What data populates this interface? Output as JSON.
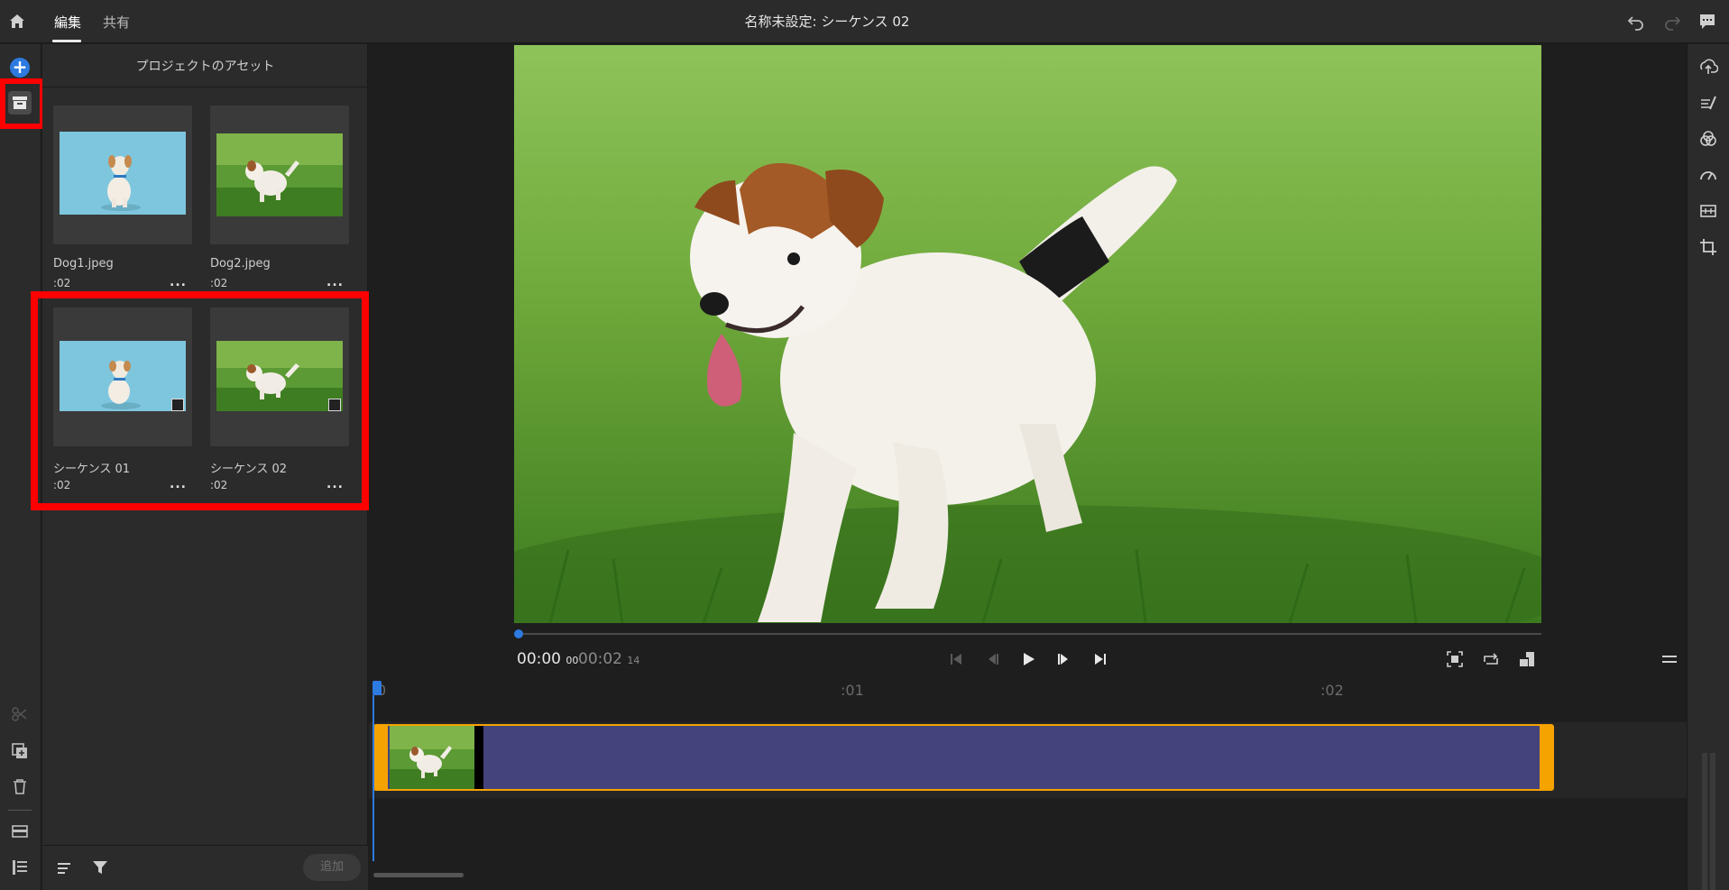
{
  "header": {
    "tabs": [
      {
        "label": "編集",
        "active": true
      },
      {
        "label": "共有",
        "active": false
      }
    ],
    "title": "名称未設定: シーケンス 02",
    "icons": [
      "home-icon",
      "undo-icon",
      "redo-icon",
      "comment-icon"
    ]
  },
  "left_rail": {
    "add_button": "+",
    "icons": [
      "add-icon",
      "project-assets-icon",
      "split-icon",
      "duplicate-icon",
      "delete-icon",
      "clip-icon",
      "properties-icon"
    ]
  },
  "assets_panel": {
    "title": "プロジェクトのアセット",
    "items": [
      {
        "name": "Dog1.jpeg",
        "duration": ":02",
        "more": "...",
        "kind": "image",
        "thumb": "dog-blue"
      },
      {
        "name": "Dog2.jpeg",
        "duration": ":02",
        "more": "...",
        "kind": "image",
        "thumb": "dog-grass"
      },
      {
        "name": "シーケンス 01",
        "duration": ":02",
        "more": "...",
        "kind": "sequence",
        "thumb": "dog-blue"
      },
      {
        "name": "シーケンス 02",
        "duration": ":02",
        "more": "...",
        "kind": "sequence",
        "thumb": "dog-grass"
      }
    ],
    "footer": {
      "add_label": "追加",
      "icons": [
        "sort-icon",
        "filter-icon"
      ]
    }
  },
  "player": {
    "time_current": "00:00",
    "time_current_frames": "00",
    "time_total": "00:02",
    "time_total_frames": "14",
    "playback_position": 0,
    "controls": [
      "go-to-start-icon",
      "step-back-icon",
      "play-icon",
      "step-forward-icon",
      "go-to-end-icon"
    ],
    "view_controls": [
      "fit-icon",
      "loop-icon",
      "aspect-icon"
    ]
  },
  "timeline": {
    "ruler_marks": [
      "0",
      ":01",
      ":02"
    ],
    "clip": {
      "thumb": "dog-grass",
      "start": 0,
      "end": 2.46
    }
  },
  "right_rail": {
    "icons": [
      "export-icon",
      "effects-icon",
      "color-icon",
      "speed-icon",
      "audio-icon",
      "crop-icon"
    ]
  },
  "colors": {
    "accent": "#2d7ae0",
    "highlight": "#ff0000",
    "clip_border": "#f5a300",
    "clip_fill": "#45437c"
  }
}
